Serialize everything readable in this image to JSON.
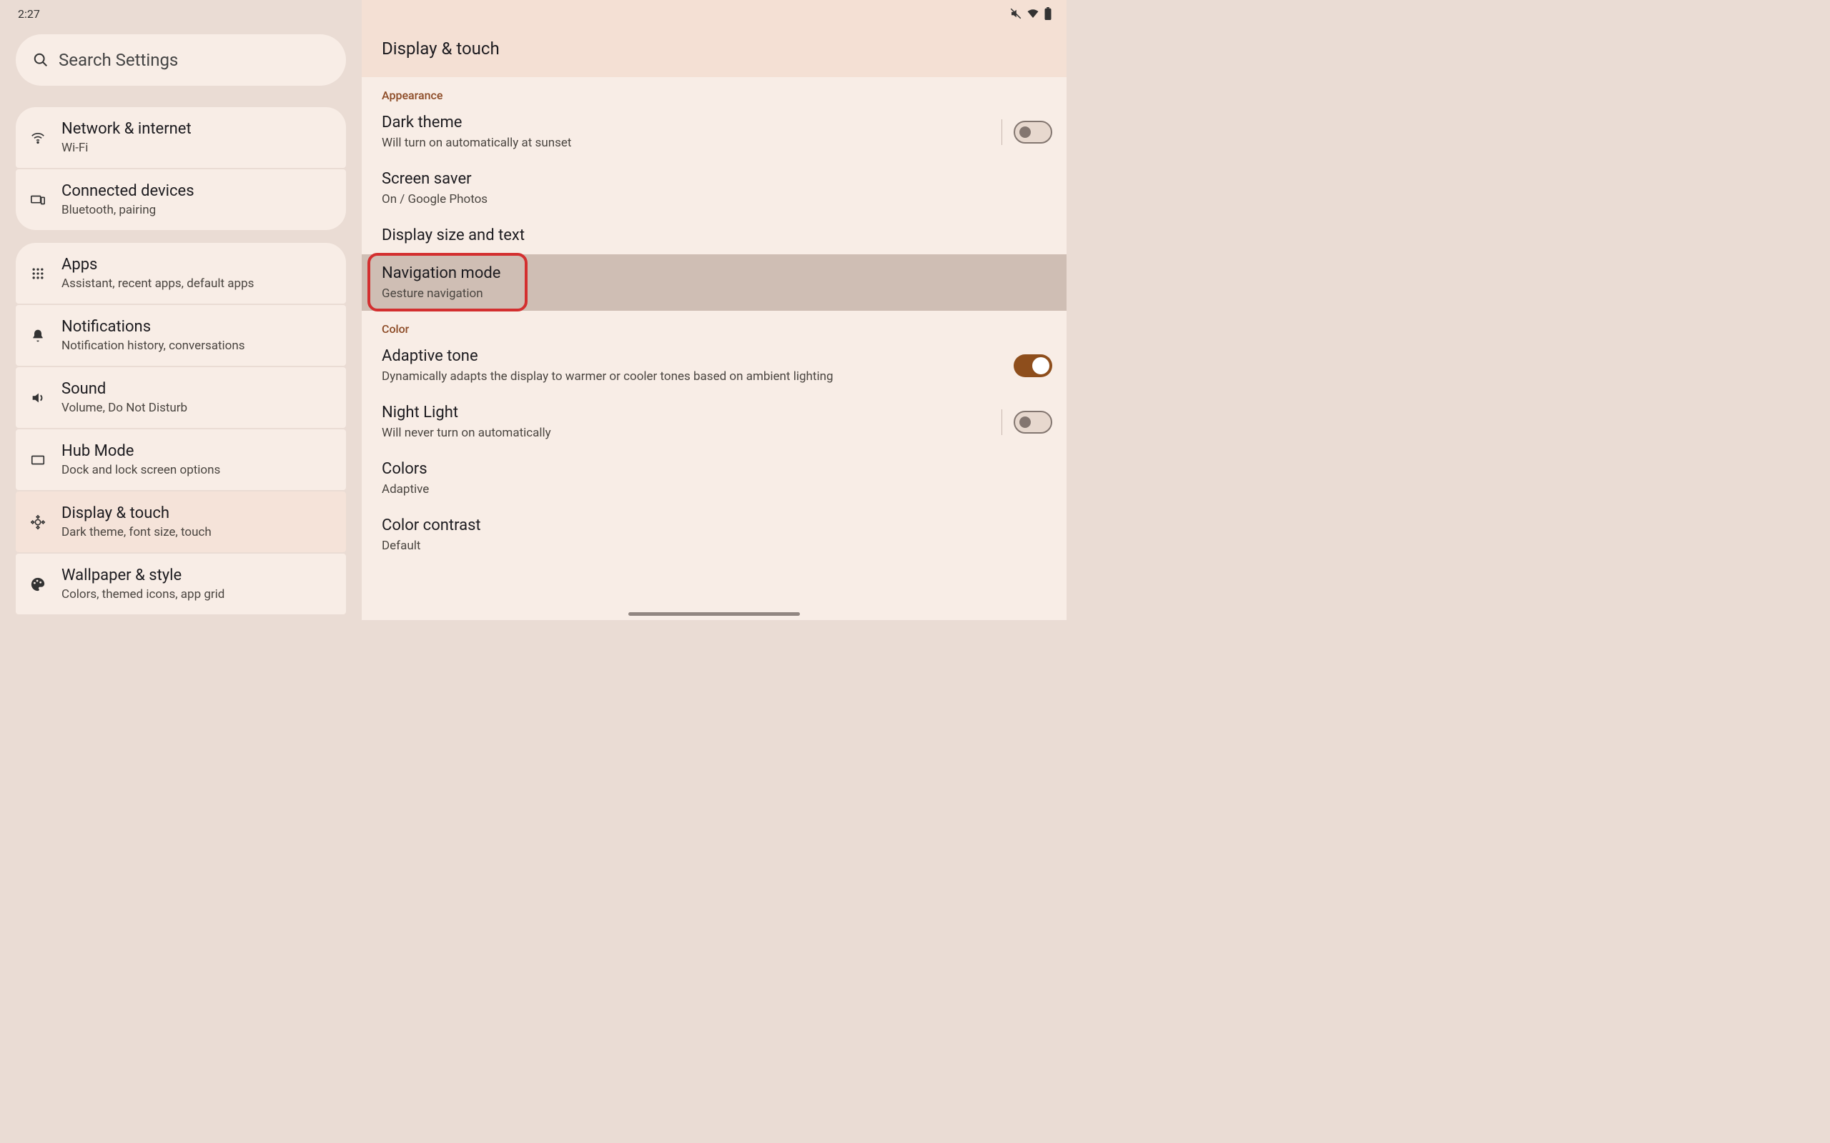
{
  "status": {
    "time": "2:27"
  },
  "search": {
    "placeholder": "Search Settings"
  },
  "sidebar": {
    "groups": [
      [
        {
          "icon": "wifi",
          "title": "Network & internet",
          "sub": "Wi-Fi"
        },
        {
          "icon": "devices",
          "title": "Connected devices",
          "sub": "Bluetooth, pairing"
        }
      ],
      [
        {
          "icon": "apps",
          "title": "Apps",
          "sub": "Assistant, recent apps, default apps"
        },
        {
          "icon": "bell",
          "title": "Notifications",
          "sub": "Notification history, conversations"
        },
        {
          "icon": "sound",
          "title": "Sound",
          "sub": "Volume, Do Not Disturb"
        },
        {
          "icon": "hub",
          "title": "Hub Mode",
          "sub": "Dock and lock screen options"
        },
        {
          "icon": "brightness",
          "title": "Display & touch",
          "sub": "Dark theme, font size, touch",
          "selected": true
        },
        {
          "icon": "palette",
          "title": "Wallpaper & style",
          "sub": "Colors, themed icons, app grid"
        }
      ]
    ]
  },
  "main": {
    "title": "Display & touch",
    "sections": [
      {
        "header": "Appearance",
        "items": [
          {
            "title": "Dark theme",
            "sub": "Will turn on automatically at sunset",
            "toggle": "off",
            "divider": true
          },
          {
            "title": "Screen saver",
            "sub": "On / Google Photos"
          },
          {
            "title": "Display size and text"
          },
          {
            "title": "Navigation mode",
            "sub": "Gesture navigation",
            "highlighted": true,
            "ring": true
          }
        ]
      },
      {
        "header": "Color",
        "items": [
          {
            "title": "Adaptive tone",
            "sub": "Dynamically adapts the display to warmer or cooler tones based on ambient lighting",
            "toggle": "on"
          },
          {
            "title": "Night Light",
            "sub": "Will never turn on automatically",
            "toggle": "off",
            "divider": true
          },
          {
            "title": "Colors",
            "sub": "Adaptive"
          },
          {
            "title": "Color contrast",
            "sub": "Default"
          }
        ]
      }
    ]
  }
}
